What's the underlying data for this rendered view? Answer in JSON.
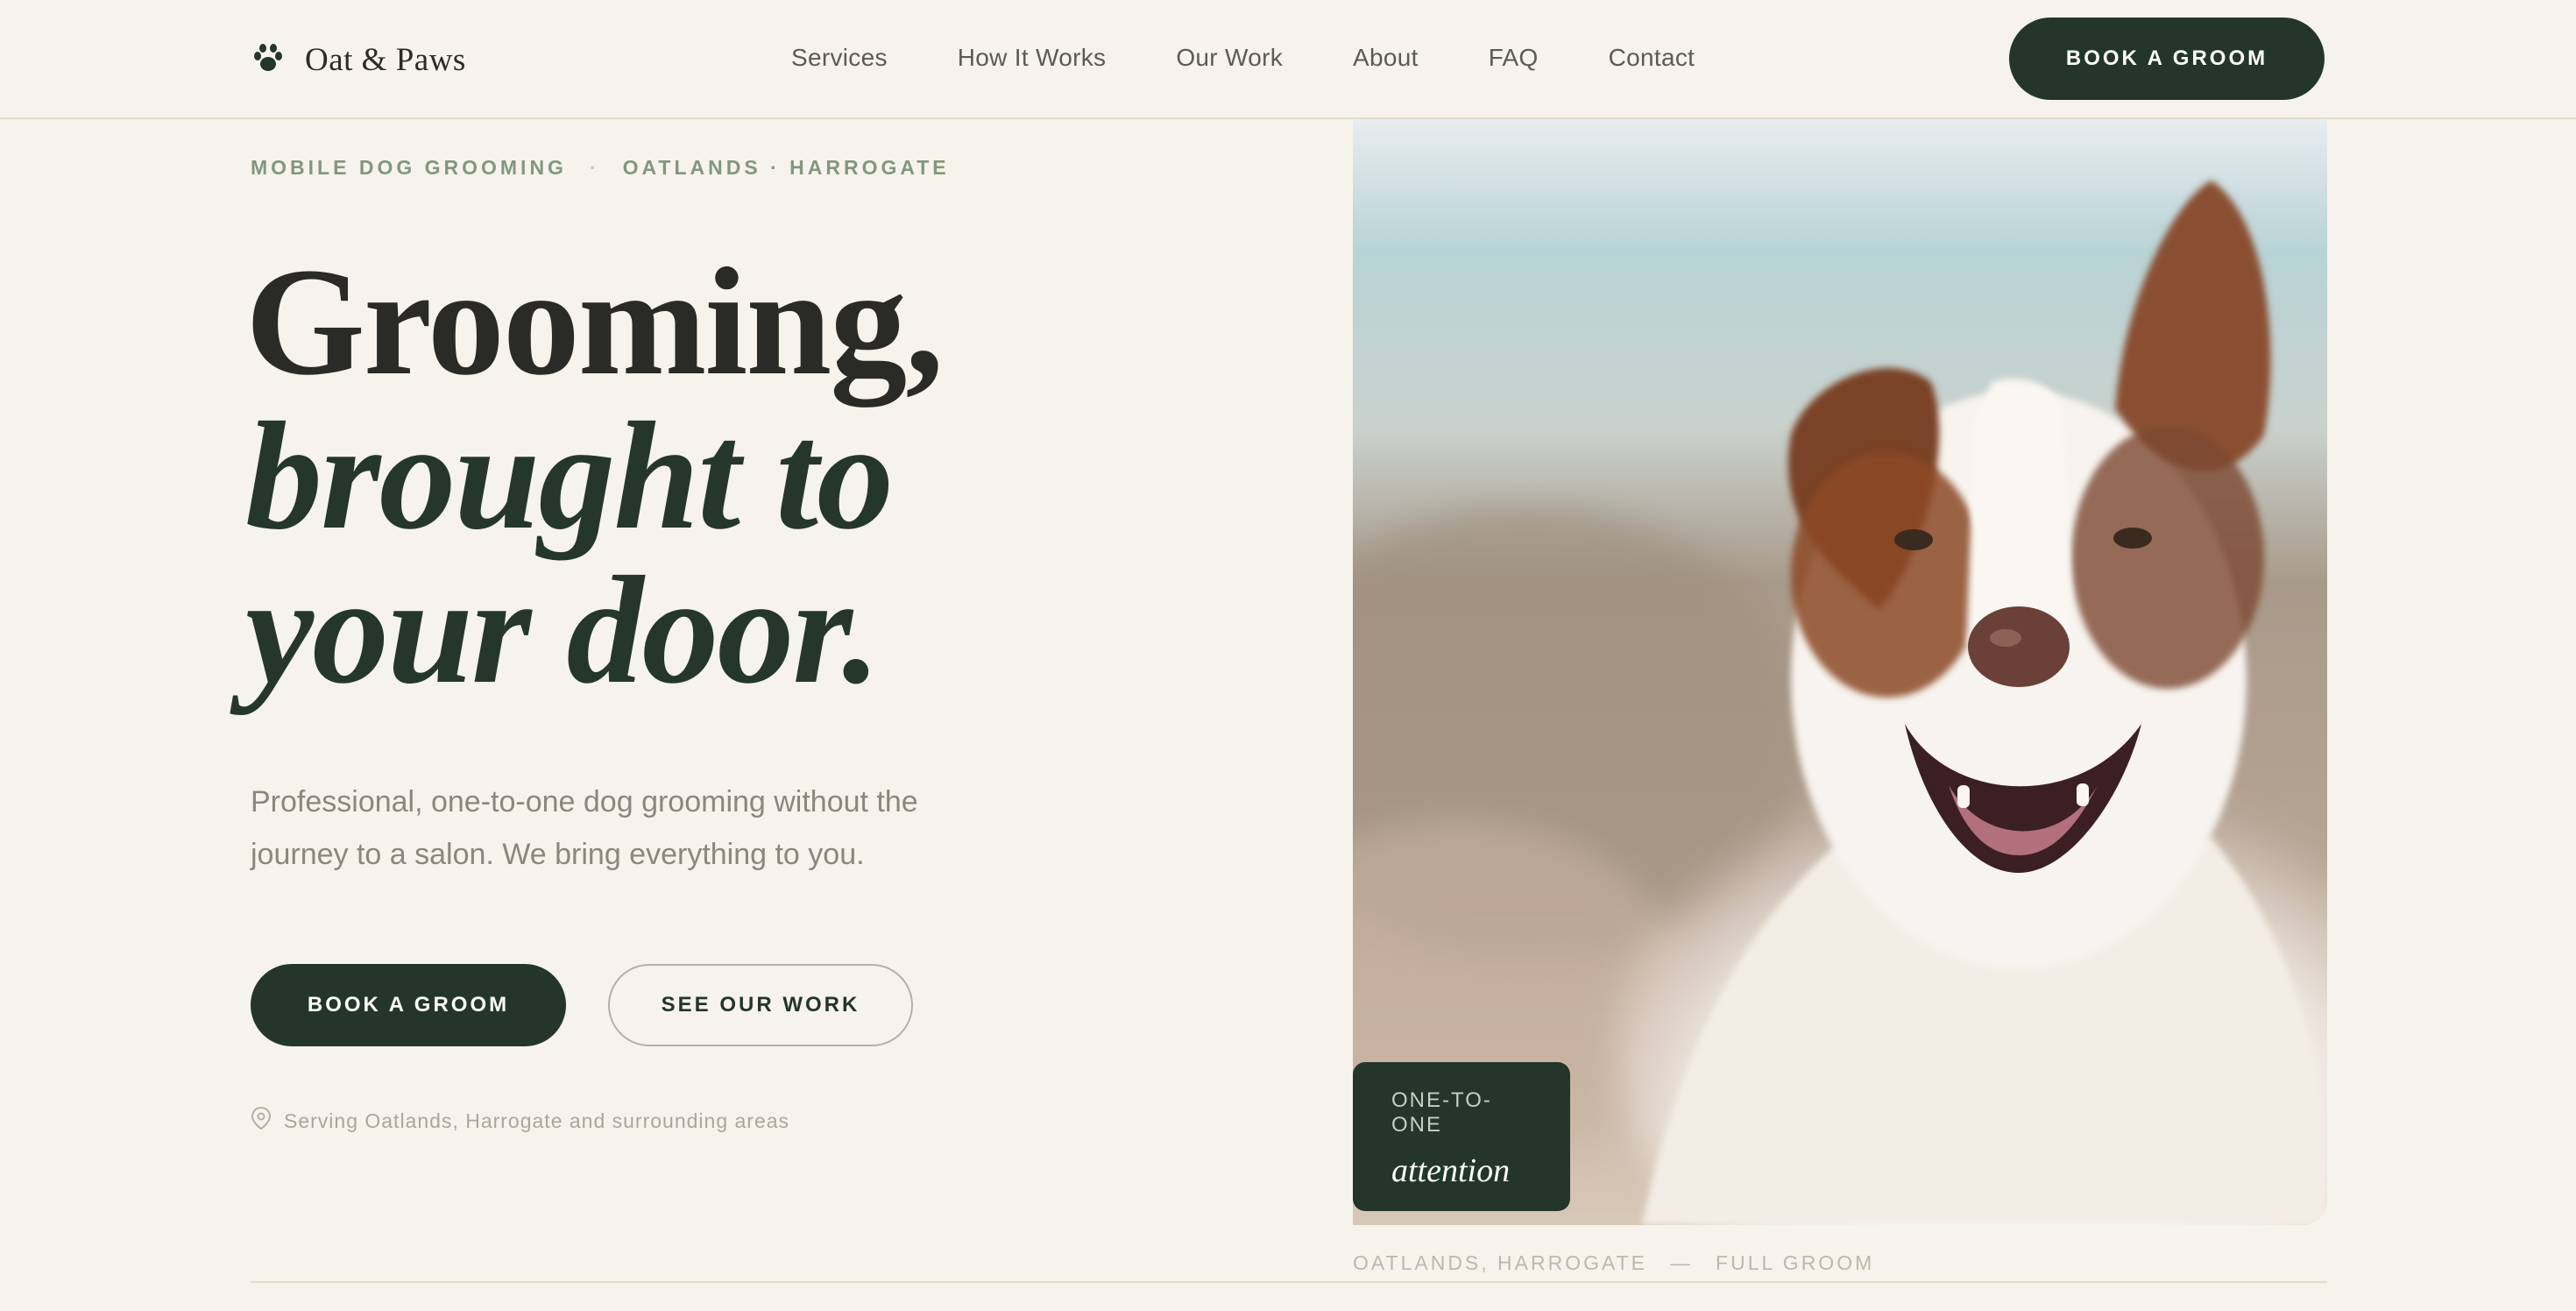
{
  "brand": {
    "name": "Oat & Paws",
    "icon": "paw-icon"
  },
  "nav": {
    "links": [
      "Services",
      "How It Works",
      "Our Work",
      "About",
      "FAQ",
      "Contact"
    ],
    "cta": "BOOK A GROOM"
  },
  "hero": {
    "eyebrow": {
      "service": "MOBILE DOG GROOMING",
      "separator": "·",
      "area": "OATLANDS · HARROGATE"
    },
    "headline": {
      "line1": "Grooming,",
      "line2": "brought to",
      "line3": "your door."
    },
    "subtext": "Professional, one-to-one dog grooming without the journey to a salon. We bring everything to you.",
    "primary_cta": "BOOK A GROOM",
    "secondary_cta": "SEE OUR WORK",
    "location": {
      "icon": "map-pin-icon",
      "text": "Serving Oatlands, Harrogate and surrounding areas"
    }
  },
  "photo": {
    "subject": "dog-photo",
    "badge": {
      "top": "ONE-TO-ONE",
      "bottom": "attention"
    },
    "caption": {
      "place": "OATLANDS, HARROGATE",
      "dash": "—",
      "service": "FULL GROOM"
    }
  },
  "colors": {
    "background": "#f6f3ec",
    "accent": "#233629",
    "muted_green": "#82977f"
  }
}
